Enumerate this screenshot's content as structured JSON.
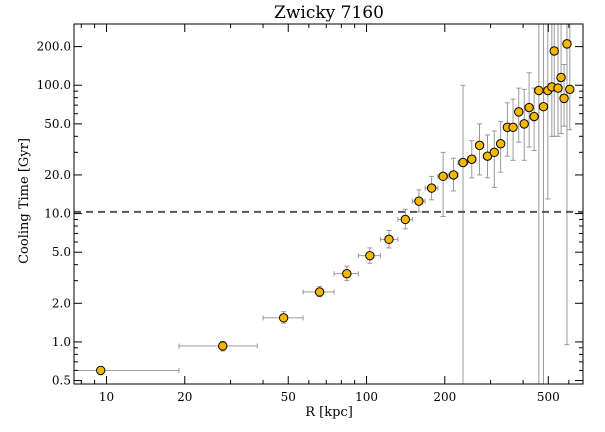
{
  "chart_data": {
    "type": "scatter",
    "title": "Zwicky 7160",
    "xlabel": "R [kpc]",
    "ylabel": "Cooling Time [Gyr]",
    "xscale": "log",
    "yscale": "log",
    "xlim": [
      7.5,
      680
    ],
    "ylim": [
      0.47,
      300
    ],
    "xticks": [
      10,
      20,
      50,
      100,
      200,
      500
    ],
    "xtick_labels": [
      "10",
      "20",
      "50",
      "100",
      "200",
      "500"
    ],
    "yticks": [
      0.5,
      1.0,
      2.0,
      5.0,
      10.0,
      20.0,
      50.0,
      100.0,
      200.0
    ],
    "ytick_labels": [
      "0.5",
      "1.0",
      "2.0",
      "5.0",
      "10.0",
      "20.0",
      "50.0",
      "100.0",
      "200.0"
    ],
    "reference_line": {
      "y": 10.3,
      "style": "dashed",
      "color": "#555555"
    },
    "marker_color": "#f5b800",
    "points": [
      {
        "x": 9.5,
        "xlo": 7.5,
        "xhi": 19,
        "y": 0.6,
        "ylo": 0.56,
        "yhi": 0.64
      },
      {
        "x": 28,
        "xlo": 19,
        "xhi": 38,
        "y": 0.93,
        "ylo": 0.85,
        "yhi": 1.01
      },
      {
        "x": 48,
        "xlo": 40,
        "xhi": 57,
        "y": 1.54,
        "ylo": 1.4,
        "yhi": 1.72
      },
      {
        "x": 66,
        "xlo": 57,
        "xhi": 75,
        "y": 2.45,
        "ylo": 2.25,
        "yhi": 2.7
      },
      {
        "x": 84,
        "xlo": 75,
        "xhi": 93,
        "y": 3.4,
        "ylo": 3.0,
        "yhi": 3.9
      },
      {
        "x": 103,
        "xlo": 93,
        "xhi": 113,
        "y": 4.7,
        "ylo": 4.1,
        "yhi": 5.4
      },
      {
        "x": 122,
        "xlo": 113,
        "xhi": 132,
        "y": 6.3,
        "ylo": 5.4,
        "yhi": 7.4
      },
      {
        "x": 141,
        "xlo": 132,
        "xhi": 150,
        "y": 9.0,
        "ylo": 7.6,
        "yhi": 10.8
      },
      {
        "x": 159,
        "xlo": 150,
        "xhi": 168,
        "y": 12.5,
        "ylo": 10.3,
        "yhi": 15.3
      },
      {
        "x": 178,
        "xlo": 168,
        "xhi": 188,
        "y": 15.8,
        "ylo": 12.8,
        "yhi": 19.5
      },
      {
        "x": 197,
        "xlo": 188,
        "xhi": 206,
        "y": 19.5,
        "ylo": 9.5,
        "yhi": 30
      },
      {
        "x": 216,
        "xlo": 206,
        "xhi": 225,
        "y": 20.0,
        "ylo": 15,
        "yhi": 27
      },
      {
        "x": 235,
        "xlo": 225,
        "xhi": 245,
        "y": 25.0,
        "ylo": 0.47,
        "yhi": 100
      },
      {
        "x": 254,
        "xlo": 245,
        "xhi": 263,
        "y": 26.5,
        "ylo": 19,
        "yhi": 37
      },
      {
        "x": 272,
        "xlo": 263,
        "xhi": 282,
        "y": 34.0,
        "ylo": 20,
        "yhi": 50
      },
      {
        "x": 292,
        "xlo": 282,
        "xhi": 301,
        "y": 28.0,
        "ylo": 19,
        "yhi": 41
      },
      {
        "x": 310,
        "xlo": 301,
        "xhi": 319,
        "y": 30.0,
        "ylo": 16,
        "yhi": 44
      },
      {
        "x": 328,
        "xlo": 319,
        "xhi": 338,
        "y": 35.0,
        "ylo": 21,
        "yhi": 52
      },
      {
        "x": 348,
        "xlo": 338,
        "xhi": 357,
        "y": 47.0,
        "ylo": 28,
        "yhi": 73
      },
      {
        "x": 366,
        "xlo": 357,
        "xhi": 376,
        "y": 47.0,
        "ylo": 26,
        "yhi": 78
      },
      {
        "x": 385,
        "xlo": 376,
        "xhi": 395,
        "y": 62.0,
        "ylo": 36,
        "yhi": 95
      },
      {
        "x": 404,
        "xlo": 395,
        "xhi": 413,
        "y": 50.0,
        "ylo": 26,
        "yhi": 93
      },
      {
        "x": 422,
        "xlo": 413,
        "xhi": 432,
        "y": 67.0,
        "ylo": 33,
        "yhi": 125
      },
      {
        "x": 441,
        "xlo": 432,
        "xhi": 451,
        "y": 57.0,
        "ylo": 31,
        "yhi": 95
      },
      {
        "x": 460,
        "xlo": 451,
        "xhi": 470,
        "y": 91.0,
        "ylo": 0.47,
        "yhi": 300
      },
      {
        "x": 479,
        "xlo": 470,
        "xhi": 488,
        "y": 68.0,
        "ylo": 0.47,
        "yhi": 300
      },
      {
        "x": 498,
        "xlo": 488,
        "xhi": 507,
        "y": 91.0,
        "ylo": 13,
        "yhi": 300
      },
      {
        "x": 516,
        "xlo": 507,
        "xhi": 526,
        "y": 97.0,
        "ylo": 40,
        "yhi": 300
      },
      {
        "x": 527,
        "xlo": 518,
        "xhi": 537,
        "y": 185,
        "ylo": 40,
        "yhi": 300
      },
      {
        "x": 545,
        "xlo": 536,
        "xhi": 555,
        "y": 95.0,
        "ylo": 40,
        "yhi": 300
      },
      {
        "x": 560,
        "xlo": 551,
        "xhi": 569,
        "y": 115,
        "ylo": 42,
        "yhi": 300
      },
      {
        "x": 575,
        "xlo": 566,
        "xhi": 584,
        "y": 79.0,
        "ylo": 48,
        "yhi": 145
      },
      {
        "x": 590,
        "xlo": 581,
        "xhi": 599,
        "y": 210,
        "ylo": 0.95,
        "yhi": 300
      },
      {
        "x": 605,
        "xlo": 596,
        "xhi": 615,
        "y": 93.0,
        "ylo": 45,
        "yhi": 300
      }
    ]
  }
}
